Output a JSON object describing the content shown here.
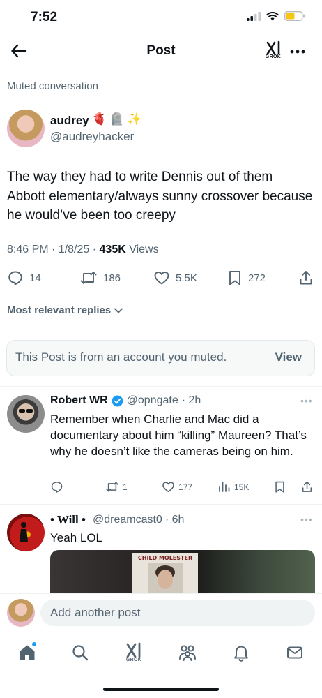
{
  "status_bar": {
    "time": "7:52"
  },
  "header": {
    "title": "Post",
    "grok_label": "GROK"
  },
  "muted_conversation": "Muted conversation",
  "post": {
    "author_name": "audrey",
    "author_emojis": [
      "🫀",
      "🪦",
      "✨"
    ],
    "author_handle": "@audreyhacker",
    "text": "The way they had to write Dennis out of them Abbott elementary/always sunny crossover because he would’ve been too creepy",
    "timestamp": "8:46 PM · 1/8/25 · ",
    "views_count": "435K",
    "views_label": " Views",
    "replies": "14",
    "reposts": "186",
    "likes": "5.5K",
    "bookmarks": "272"
  },
  "sort_label": "Most relevant replies",
  "muted_notice": {
    "text": "This Post is from an account you muted.",
    "view_label": "View"
  },
  "replies": [
    {
      "name": "Robert WR",
      "handle": "@opngate",
      "time": "· 2h",
      "text": "Remember when Charlie and Mac did a documentary about him “killing” Maureen? That’s why he doesn’t like the cameras being on him.",
      "replies": "",
      "reposts": "1",
      "likes": "177",
      "views": "15K"
    },
    {
      "name": "• Will •",
      "handle": "@dreamcast0",
      "time": "· 6h",
      "text": "Yeah LOL",
      "media_text": "CHILD MOLESTER"
    }
  ],
  "compose": {
    "placeholder": "Add another post"
  },
  "nav": {
    "grok_label": "GROK"
  },
  "colors": {
    "accent": "#1d9bf0",
    "text": "#0f1419",
    "muted": "#536471"
  }
}
